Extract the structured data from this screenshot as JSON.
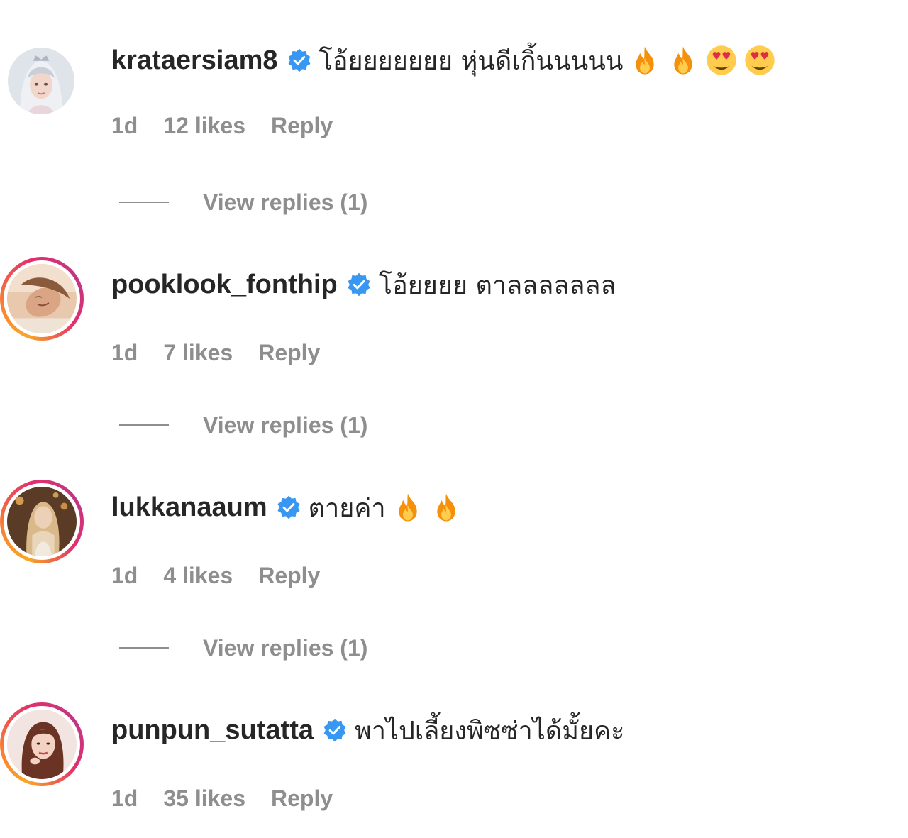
{
  "comments": [
    {
      "username": "krataersiam8",
      "text": "โอ้ยยยยยยย หุ่นดีเกิ้นนนนน",
      "emojis": [
        "fire",
        "fire",
        "heart-eyes",
        "heart-eyes"
      ],
      "time": "1d",
      "likes": "12 likes",
      "reply": "Reply",
      "view_replies": "View replies (1)"
    },
    {
      "username": "pooklook_fonthip",
      "text": "โอ้ยยยย ตาลลลลลลล",
      "emojis": [],
      "time": "1d",
      "likes": "7 likes",
      "reply": "Reply",
      "view_replies": "View replies (1)"
    },
    {
      "username": "lukkanaaum",
      "text": "ตายค่า",
      "emojis": [
        "fire",
        "fire"
      ],
      "time": "1d",
      "likes": "4 likes",
      "reply": "Reply",
      "view_replies": "View replies (1)"
    },
    {
      "username": "punpun_sutatta",
      "text": "พาไปเลี้ยงพิซซ่าได้มั้ยคะ",
      "emojis": [],
      "time": "1d",
      "likes": "35 likes",
      "reply": "Reply"
    }
  ],
  "colors": {
    "text": "#262626",
    "secondary": "#8e8e8e",
    "verified": "#3897f0"
  }
}
